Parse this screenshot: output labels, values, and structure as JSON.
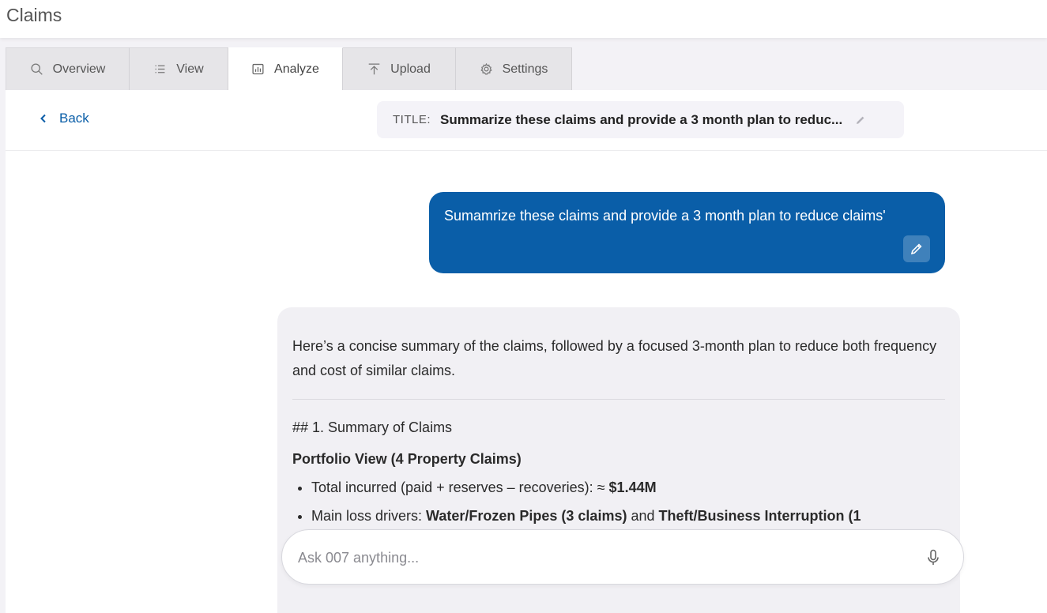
{
  "app": {
    "title": "Claims"
  },
  "tabs": [
    {
      "label": "Overview",
      "icon": "search-icon",
      "active": false
    },
    {
      "label": "View",
      "icon": "list-icon",
      "active": false
    },
    {
      "label": "Analyze",
      "icon": "bar-chart-icon",
      "active": true
    },
    {
      "label": "Upload",
      "icon": "upload-icon",
      "active": false
    },
    {
      "label": "Settings",
      "icon": "gear-icon",
      "active": false
    }
  ],
  "subheader": {
    "back_label": "Back",
    "title_label": "TITLE:",
    "title_value": "Summarize these claims and provide a 3 month plan to reduc..."
  },
  "chat": {
    "user_message": "Sumamrize these claims and provide a 3 month plan to reduce claims'",
    "assistant": {
      "intro": "Here’s a concise summary of the claims, followed by a focused 3-month plan to reduce both frequency and cost of similar claims.",
      "heading": "## 1. Summary of Claims",
      "subheading": "Portfolio View (4 Property Claims)",
      "bullets": [
        {
          "prefix": "Total incurred (paid + reserves – recoveries): ≈ ",
          "bold": "$1.44M",
          "mid": "",
          "bold2": ""
        },
        {
          "prefix": "Main loss drivers: ",
          "bold": "Water/Frozen Pipes (3 claims)",
          "mid": " and ",
          "bold2": "Theft/Business Interruption (1"
        }
      ]
    }
  },
  "input": {
    "placeholder": "Ask 007 anything..."
  },
  "colors": {
    "accent": "#0a5ea8",
    "bubble_bg": "#f1f0f4"
  }
}
